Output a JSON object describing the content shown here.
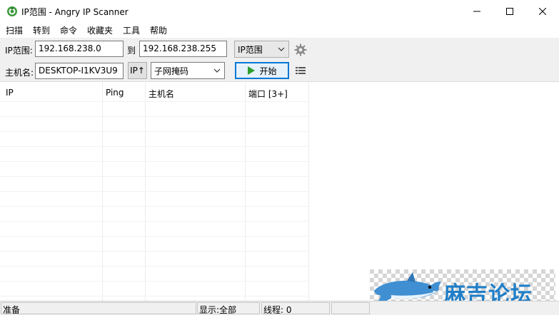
{
  "window": {
    "title": "IP范围 - Angry IP Scanner"
  },
  "menu": {
    "items": [
      "扫描",
      "转到",
      "命令",
      "收藏夹",
      "工具",
      "帮助"
    ]
  },
  "toolbar": {
    "ip_range_label": "IP范围:",
    "ip_start": "192.168.238.0",
    "to_label": "到",
    "ip_end": "192.168.238.255",
    "feeder_select": "IP范围",
    "hostname_label": "主机名:",
    "hostname": "DESKTOP-I1KV3U9",
    "ip_up_button": "IP↑",
    "netmask_select": "子网掩码",
    "start_button": "开始"
  },
  "table": {
    "columns": [
      "IP",
      "Ping",
      "主机名",
      "端口 [3+]"
    ],
    "rows": []
  },
  "status": {
    "state": "准备",
    "display": "显示:全部",
    "threads": "线程: 0"
  },
  "watermark": {
    "text": "麻吉论坛"
  },
  "colors": {
    "start_play": "#2e9e2e",
    "accent_border": "#0078d7",
    "watermark_text": "#1f7ec8"
  }
}
